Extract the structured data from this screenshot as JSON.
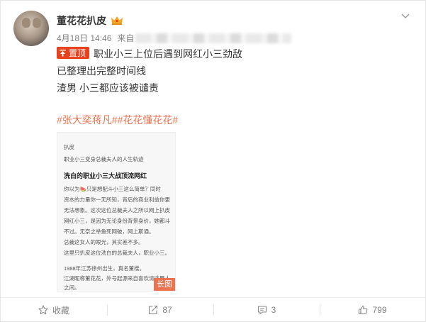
{
  "post": {
    "username": "董花花扒皮",
    "date": "4月18日 14:46",
    "source_prefix": "来自",
    "pin_label": "置顶",
    "lines": [
      "职业小三上位后遇到网红小三劲敌",
      "已整理出完整时间线",
      "渣男 小三都应该被谴责"
    ],
    "hashtags": "#张大奕蒋凡##花花懂花花#"
  },
  "thumbnail": {
    "lines": [
      "扒皮",
      "职业小三变身总裁夫人的人生轨迹",
      "洗白的职业小三大战顶流网红",
      "你以为🍉只是想配斗小三这么简单？同时",
      "资本的力量你一无所知，背后的商业利益你更",
      "无法想象。这次这位总裁夫人之所以网上扒皮",
      "网红小三，是因为无论身份背景身价，她都斗",
      "不过。无奈之举鱼死网破，网上斯通。",
      "总裁这女人的眼光，其实差不多。",
      "这里只扒皮这位洗白的总裁夫人，职业小三。",
      "1988年江苏徐州出生，真名董楼。",
      "江湖昵称董花花，外号起源来自喜欢清逃男人",
      "之间。"
    ],
    "long_image_label": "长图"
  },
  "actions": {
    "favorite": "收藏",
    "repost": "87",
    "comment": "3",
    "like": "799"
  },
  "colors": {
    "accent": "#eb7350",
    "pin": "#e8411d",
    "muted": "#808080"
  }
}
